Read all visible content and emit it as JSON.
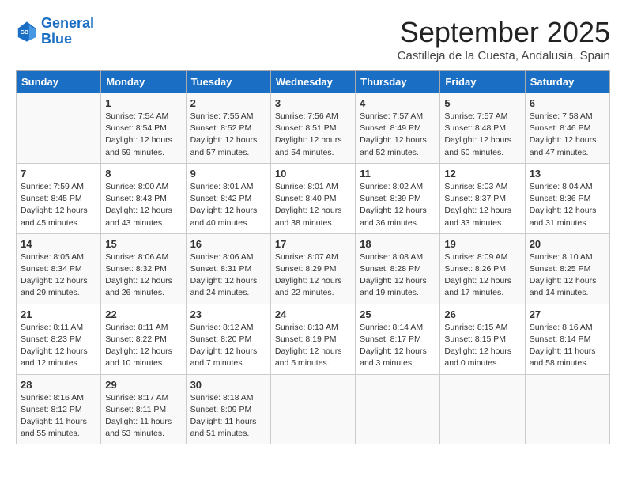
{
  "header": {
    "logo_line1": "General",
    "logo_line2": "Blue",
    "month": "September 2025",
    "location": "Castilleja de la Cuesta, Andalusia, Spain"
  },
  "weekdays": [
    "Sunday",
    "Monday",
    "Tuesday",
    "Wednesday",
    "Thursday",
    "Friday",
    "Saturday"
  ],
  "weeks": [
    [
      {
        "day": "",
        "detail": ""
      },
      {
        "day": "1",
        "detail": "Sunrise: 7:54 AM\nSunset: 8:54 PM\nDaylight: 12 hours\nand 59 minutes."
      },
      {
        "day": "2",
        "detail": "Sunrise: 7:55 AM\nSunset: 8:52 PM\nDaylight: 12 hours\nand 57 minutes."
      },
      {
        "day": "3",
        "detail": "Sunrise: 7:56 AM\nSunset: 8:51 PM\nDaylight: 12 hours\nand 54 minutes."
      },
      {
        "day": "4",
        "detail": "Sunrise: 7:57 AM\nSunset: 8:49 PM\nDaylight: 12 hours\nand 52 minutes."
      },
      {
        "day": "5",
        "detail": "Sunrise: 7:57 AM\nSunset: 8:48 PM\nDaylight: 12 hours\nand 50 minutes."
      },
      {
        "day": "6",
        "detail": "Sunrise: 7:58 AM\nSunset: 8:46 PM\nDaylight: 12 hours\nand 47 minutes."
      }
    ],
    [
      {
        "day": "7",
        "detail": "Sunrise: 7:59 AM\nSunset: 8:45 PM\nDaylight: 12 hours\nand 45 minutes."
      },
      {
        "day": "8",
        "detail": "Sunrise: 8:00 AM\nSunset: 8:43 PM\nDaylight: 12 hours\nand 43 minutes."
      },
      {
        "day": "9",
        "detail": "Sunrise: 8:01 AM\nSunset: 8:42 PM\nDaylight: 12 hours\nand 40 minutes."
      },
      {
        "day": "10",
        "detail": "Sunrise: 8:01 AM\nSunset: 8:40 PM\nDaylight: 12 hours\nand 38 minutes."
      },
      {
        "day": "11",
        "detail": "Sunrise: 8:02 AM\nSunset: 8:39 PM\nDaylight: 12 hours\nand 36 minutes."
      },
      {
        "day": "12",
        "detail": "Sunrise: 8:03 AM\nSunset: 8:37 PM\nDaylight: 12 hours\nand 33 minutes."
      },
      {
        "day": "13",
        "detail": "Sunrise: 8:04 AM\nSunset: 8:36 PM\nDaylight: 12 hours\nand 31 minutes."
      }
    ],
    [
      {
        "day": "14",
        "detail": "Sunrise: 8:05 AM\nSunset: 8:34 PM\nDaylight: 12 hours\nand 29 minutes."
      },
      {
        "day": "15",
        "detail": "Sunrise: 8:06 AM\nSunset: 8:32 PM\nDaylight: 12 hours\nand 26 minutes."
      },
      {
        "day": "16",
        "detail": "Sunrise: 8:06 AM\nSunset: 8:31 PM\nDaylight: 12 hours\nand 24 minutes."
      },
      {
        "day": "17",
        "detail": "Sunrise: 8:07 AM\nSunset: 8:29 PM\nDaylight: 12 hours\nand 22 minutes."
      },
      {
        "day": "18",
        "detail": "Sunrise: 8:08 AM\nSunset: 8:28 PM\nDaylight: 12 hours\nand 19 minutes."
      },
      {
        "day": "19",
        "detail": "Sunrise: 8:09 AM\nSunset: 8:26 PM\nDaylight: 12 hours\nand 17 minutes."
      },
      {
        "day": "20",
        "detail": "Sunrise: 8:10 AM\nSunset: 8:25 PM\nDaylight: 12 hours\nand 14 minutes."
      }
    ],
    [
      {
        "day": "21",
        "detail": "Sunrise: 8:11 AM\nSunset: 8:23 PM\nDaylight: 12 hours\nand 12 minutes."
      },
      {
        "day": "22",
        "detail": "Sunrise: 8:11 AM\nSunset: 8:22 PM\nDaylight: 12 hours\nand 10 minutes."
      },
      {
        "day": "23",
        "detail": "Sunrise: 8:12 AM\nSunset: 8:20 PM\nDaylight: 12 hours\nand 7 minutes."
      },
      {
        "day": "24",
        "detail": "Sunrise: 8:13 AM\nSunset: 8:19 PM\nDaylight: 12 hours\nand 5 minutes."
      },
      {
        "day": "25",
        "detail": "Sunrise: 8:14 AM\nSunset: 8:17 PM\nDaylight: 12 hours\nand 3 minutes."
      },
      {
        "day": "26",
        "detail": "Sunrise: 8:15 AM\nSunset: 8:15 PM\nDaylight: 12 hours\nand 0 minutes."
      },
      {
        "day": "27",
        "detail": "Sunrise: 8:16 AM\nSunset: 8:14 PM\nDaylight: 11 hours\nand 58 minutes."
      }
    ],
    [
      {
        "day": "28",
        "detail": "Sunrise: 8:16 AM\nSunset: 8:12 PM\nDaylight: 11 hours\nand 55 minutes."
      },
      {
        "day": "29",
        "detail": "Sunrise: 8:17 AM\nSunset: 8:11 PM\nDaylight: 11 hours\nand 53 minutes."
      },
      {
        "day": "30",
        "detail": "Sunrise: 8:18 AM\nSunset: 8:09 PM\nDaylight: 11 hours\nand 51 minutes."
      },
      {
        "day": "",
        "detail": ""
      },
      {
        "day": "",
        "detail": ""
      },
      {
        "day": "",
        "detail": ""
      },
      {
        "day": "",
        "detail": ""
      }
    ]
  ]
}
